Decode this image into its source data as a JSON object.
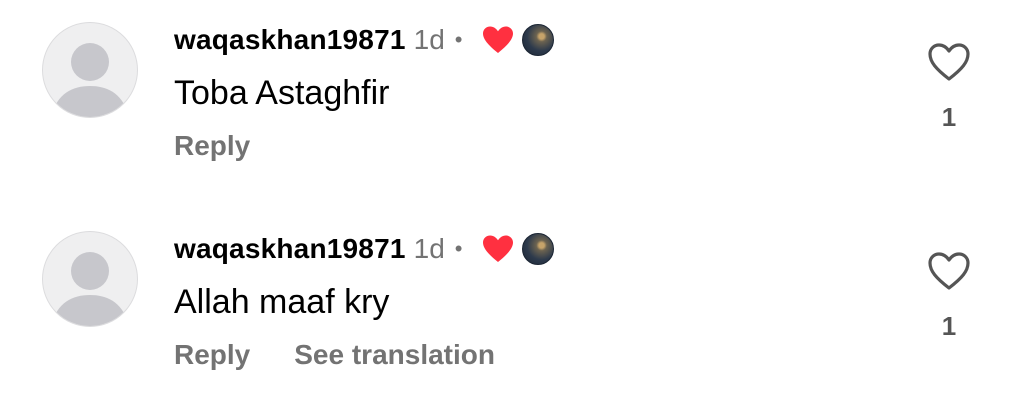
{
  "comments": [
    {
      "username": "waqaskhan19871",
      "time": "1d",
      "separator": "•",
      "text": "Toba Astaghfir",
      "reply_label": "Reply",
      "like_count": "1",
      "liked_by_creator": true
    },
    {
      "username": "waqaskhan19871",
      "time": "1d",
      "separator": "•",
      "text": "Allah maaf kry",
      "reply_label": "Reply",
      "translate_label": "See translation",
      "like_count": "1",
      "liked_by_creator": true
    }
  ],
  "colors": {
    "secondary_text": "#737373",
    "heart_red": "#ff3040",
    "avatar_bg": "#efeff0",
    "avatar_silhouette": "#c7c7cc"
  },
  "icons": {
    "avatar": "default-person-avatar-icon",
    "creator_heart": "filled-heart-icon",
    "creator_avatar": "creator-profile-icon",
    "like": "outline-heart-icon"
  }
}
